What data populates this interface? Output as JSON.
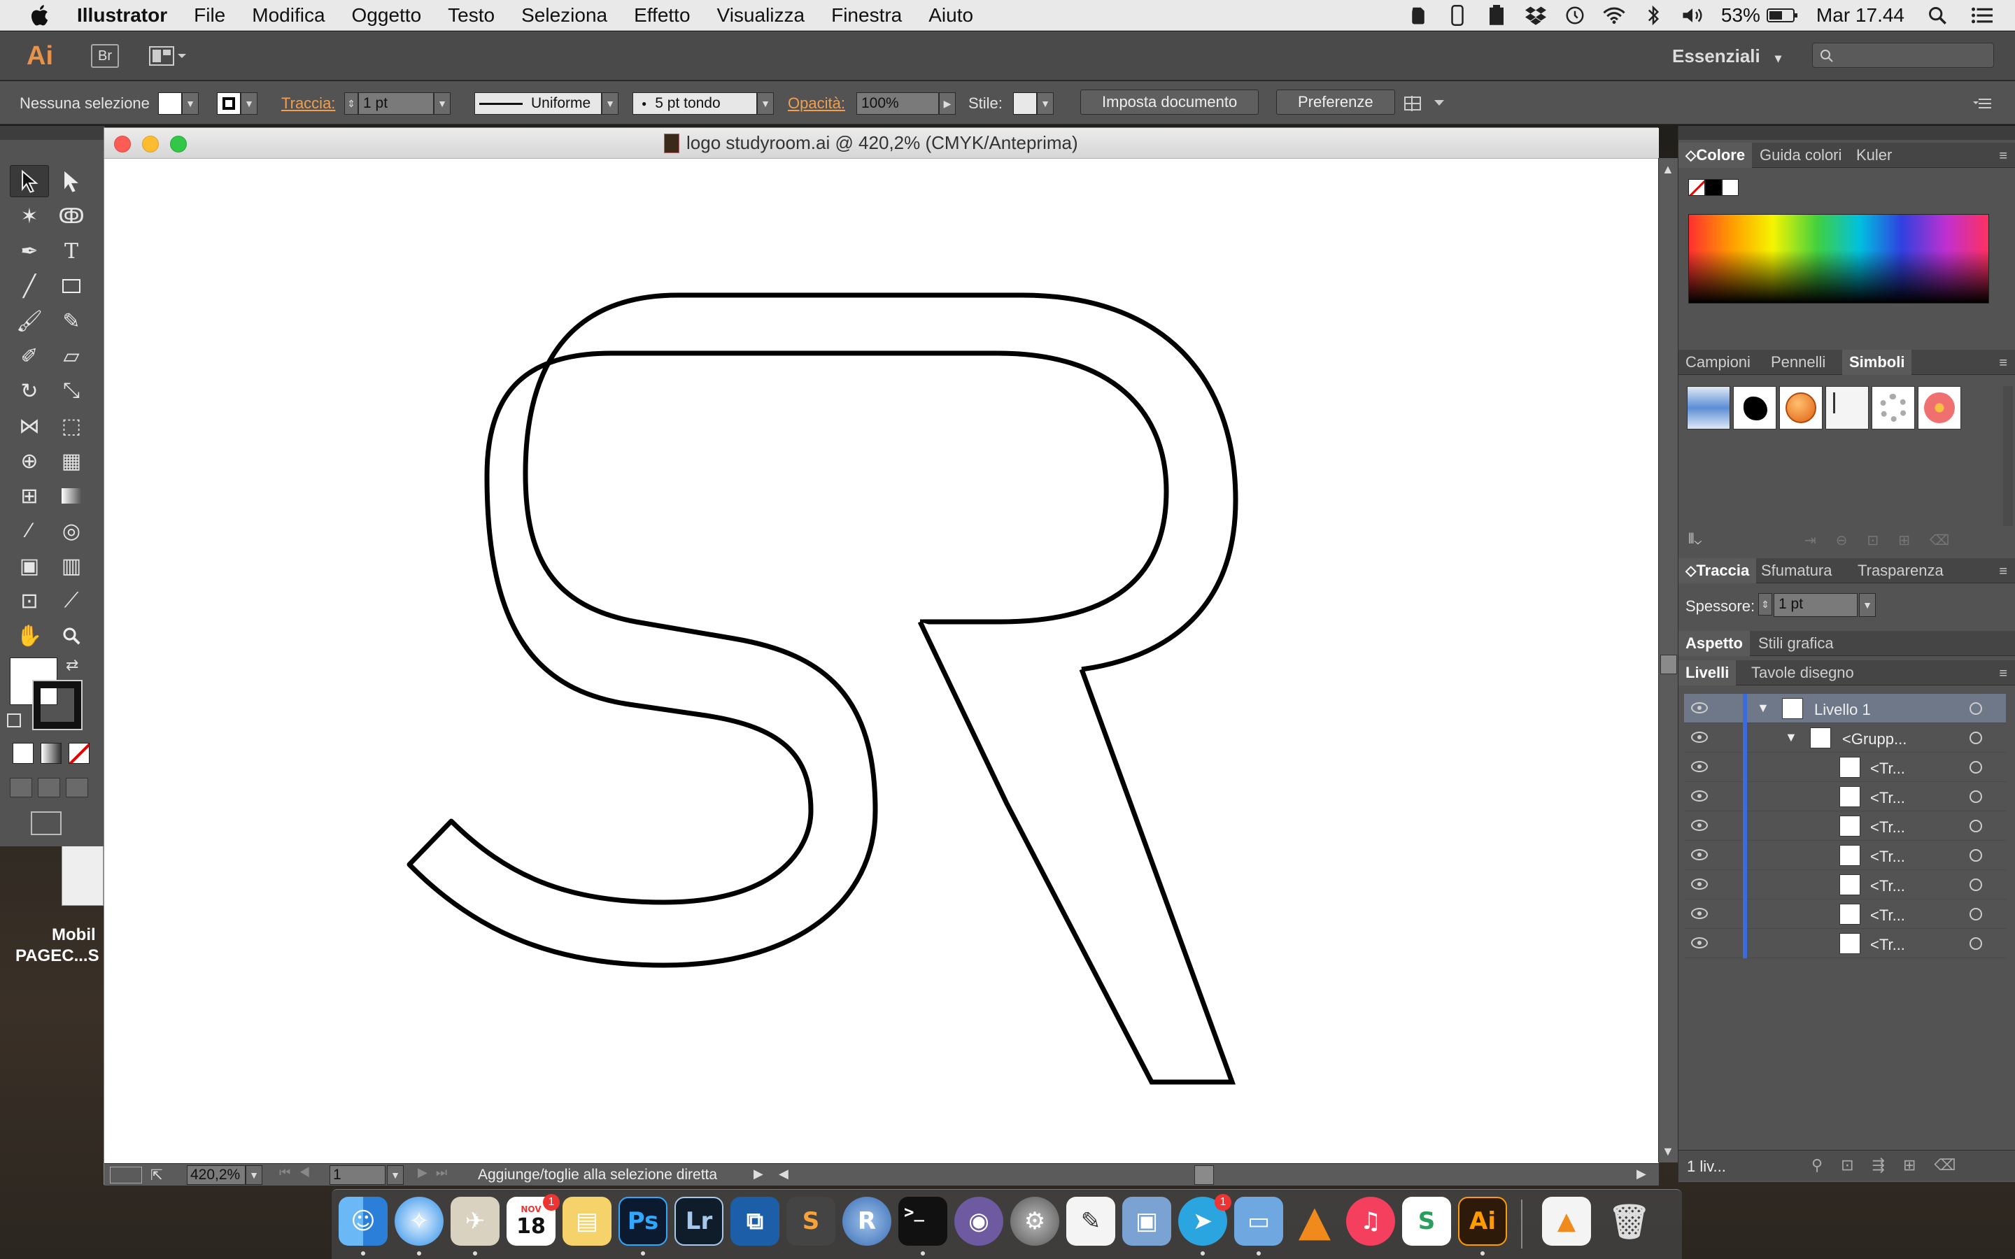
{
  "menubar": {
    "app": "Illustrator",
    "items": [
      "File",
      "Modifica",
      "Oggetto",
      "Testo",
      "Seleziona",
      "Effetto",
      "Visualizza",
      "Finestra",
      "Aiuto"
    ],
    "battery": "53%",
    "clock": "Mar 17.44"
  },
  "appbar": {
    "logo": "Ai",
    "bridge": "Br",
    "workspace": "Essenziali"
  },
  "control": {
    "selection": "Nessuna selezione",
    "stroke_label": "Traccia:",
    "stroke_weight": "1 pt",
    "profile": "Uniforme",
    "brush": "5 pt tondo",
    "opacity_label": "Opacità:",
    "opacity": "100%",
    "style_label": "Stile:",
    "doc_setup": "Imposta documento",
    "prefs": "Preferenze"
  },
  "document": {
    "title": "logo studyroom.ai @ 420,2% (CMYK/Anteprima)",
    "zoom": "420,2%",
    "artboard": "1",
    "status": "Aggiunge/toglie alla selezione diretta"
  },
  "panels": {
    "color_tabs": [
      "Colore",
      "Guida colori",
      "Kuler"
    ],
    "swatch_tabs": [
      "Campioni",
      "Pennelli",
      "Simboli"
    ],
    "stroke_tabs": [
      "Traccia",
      "Sfumatura",
      "Trasparenza"
    ],
    "stroke_weight_label": "Spessore:",
    "stroke_weight": "1 pt",
    "appearance_tabs": [
      "Aspetto",
      "Stili grafica"
    ],
    "layer_tabs": [
      "Livelli",
      "Tavole disegno"
    ],
    "layers": [
      {
        "label": "Livello 1"
      },
      {
        "label": "<Grupp..."
      },
      {
        "label": "<Tr..."
      },
      {
        "label": "<Tr..."
      },
      {
        "label": "<Tr..."
      },
      {
        "label": "<Tr..."
      },
      {
        "label": "<Tr..."
      },
      {
        "label": "<Tr..."
      },
      {
        "label": "<Tr..."
      }
    ],
    "layers_footer": "1 liv..."
  },
  "desktop": {
    "item_label_1": "Mobil",
    "item_label_2": "PAGEC...S"
  },
  "dock": {
    "calendar_month": "NOV",
    "calendar_day": "18",
    "calendar_badge": "1",
    "telegram_badge": "1",
    "ps": "Ps",
    "lr": "Lr",
    "ai": "Ai",
    "r": "R",
    "s": "S"
  }
}
